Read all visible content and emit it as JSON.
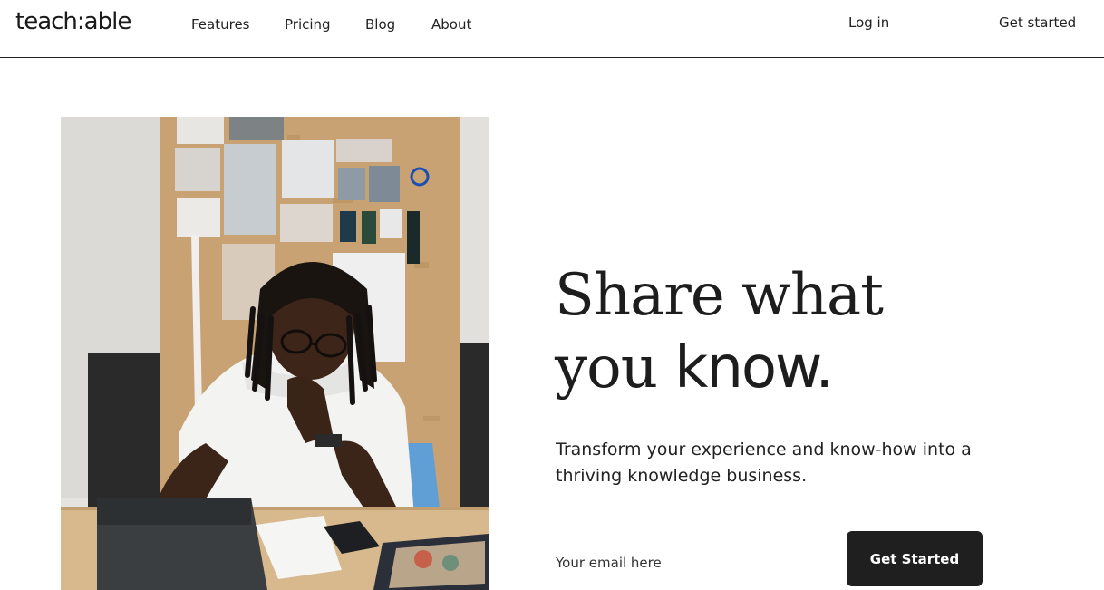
{
  "header": {
    "logo": "teach:able",
    "nav": [
      "Features",
      "Pricing",
      "Blog",
      "About"
    ],
    "login": "Log in",
    "get_started": "Get started"
  },
  "hero": {
    "headline_line1": "Share what",
    "headline_line2_a": "you ",
    "headline_line2_b": "know.",
    "subtitle": "Transform your experience and know-how into a thriving knowledge business.",
    "email_placeholder": "Your email here",
    "cta": "Get Started"
  }
}
